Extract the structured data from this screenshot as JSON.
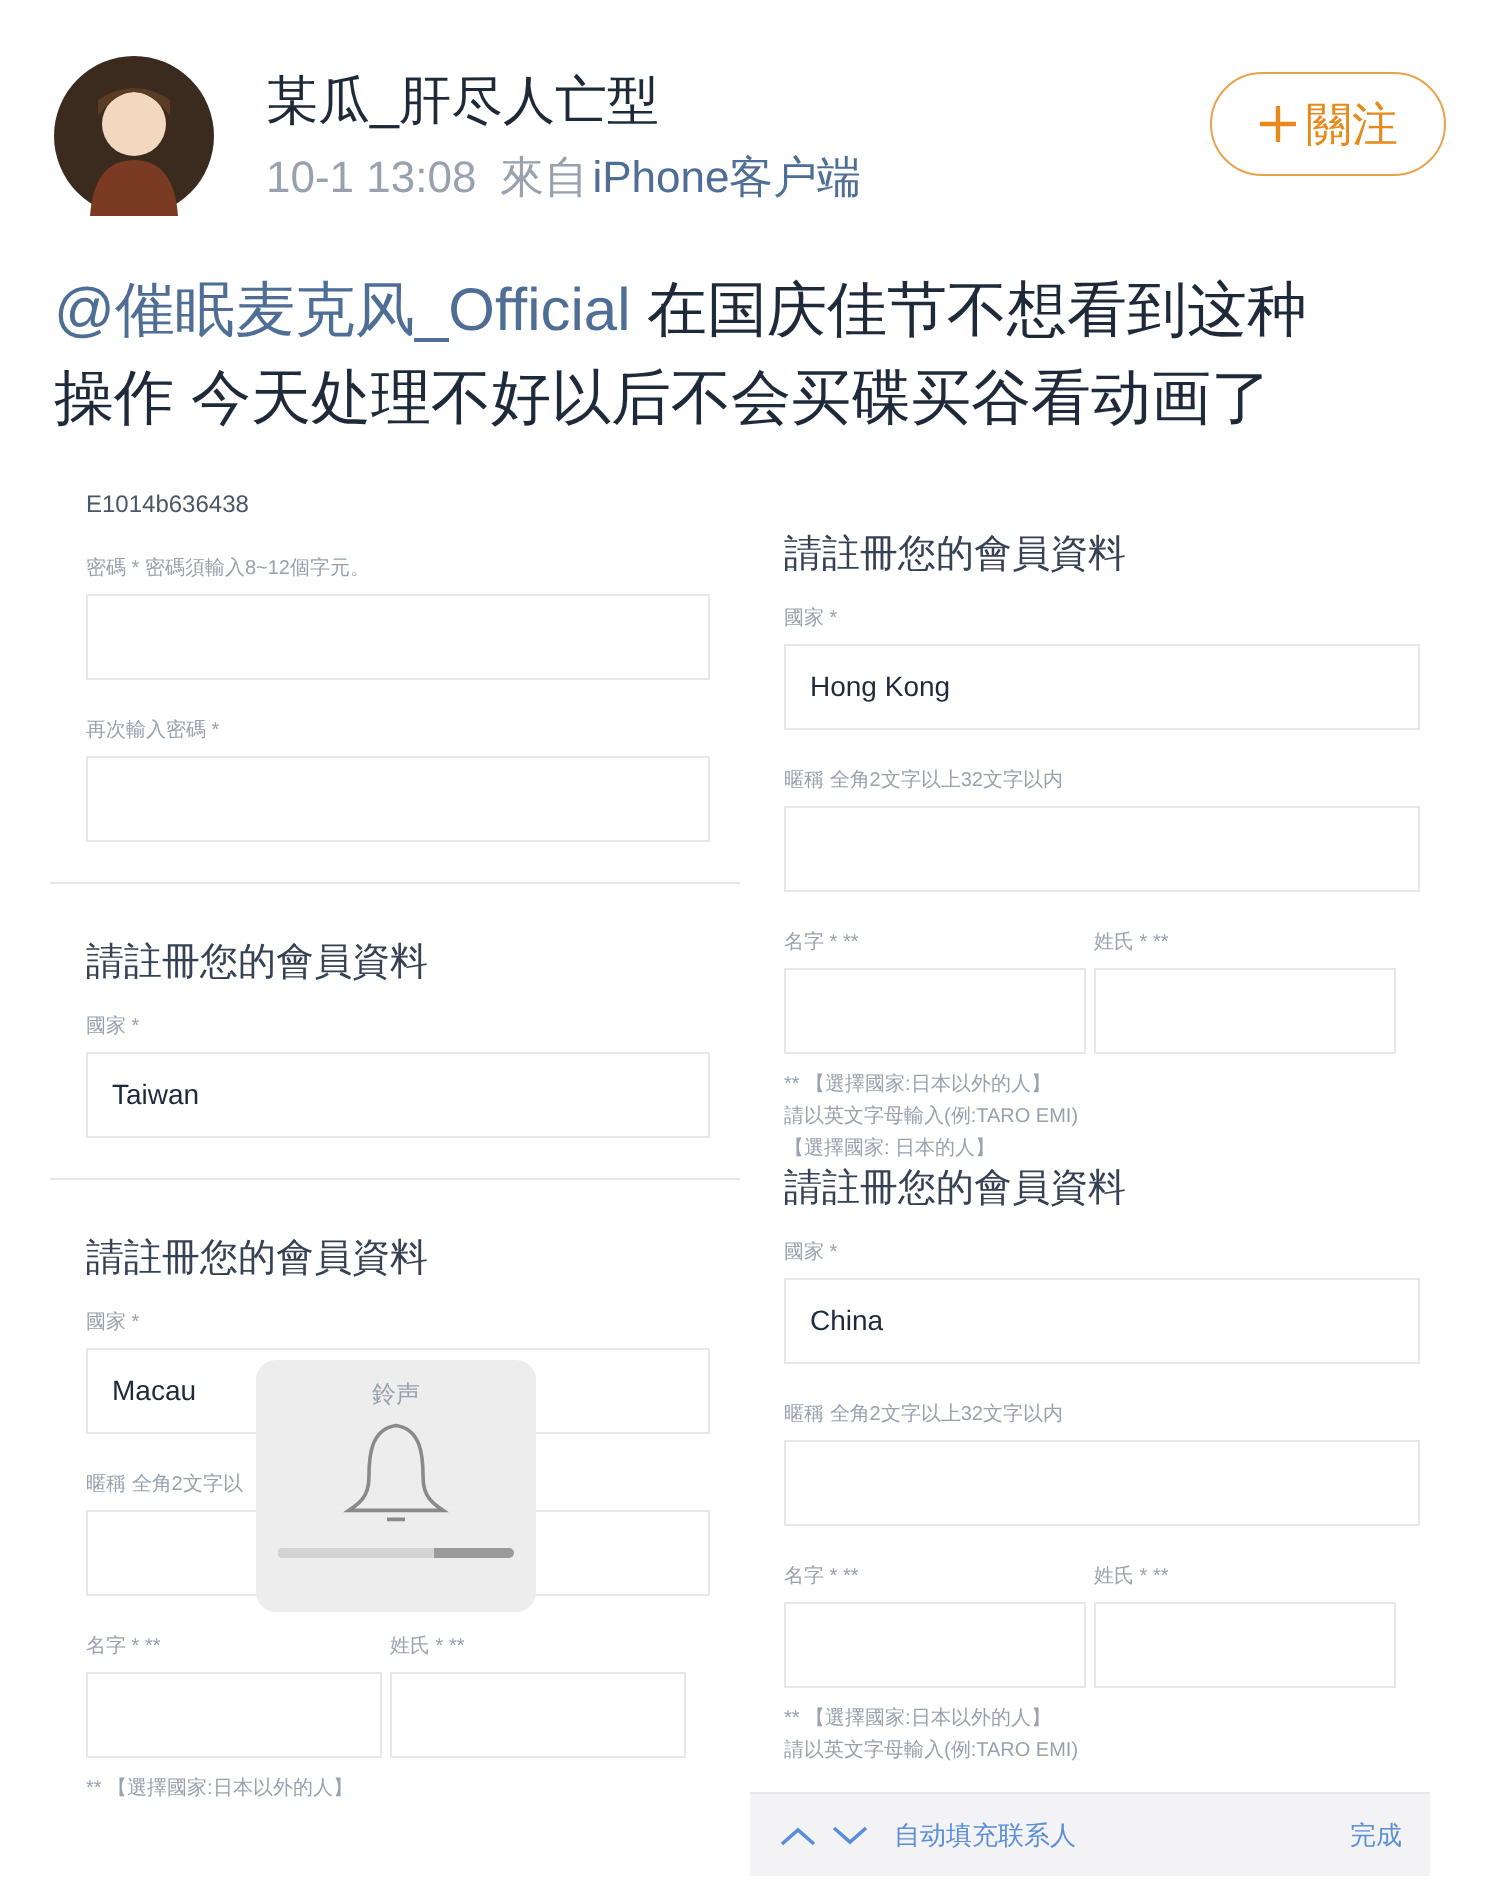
{
  "post": {
    "author": "某瓜_肝尽人亡型",
    "time": "10-1 13:08",
    "source_prefix": "來自",
    "source": "iPhone客户端",
    "follow_button": "關注",
    "mention": "@催眠麦克风_Official",
    "body": "在国庆佳节不想看到这种操作 今天处理不好以后不会买碟买谷看动画了"
  },
  "screenshot": {
    "left_column": [
      {
        "kind": "text",
        "text": "E1014b636438"
      },
      {
        "kind": "field",
        "label": "密碼 * 密碼須輸入8~12個字元。"
      },
      {
        "kind": "field",
        "label": "再次輸入密碼 *"
      },
      {
        "kind": "divider"
      },
      {
        "kind": "heading",
        "text": "請註冊您的會員資料"
      },
      {
        "kind": "field",
        "label": "國家 *",
        "value": "Taiwan"
      },
      {
        "kind": "divider"
      },
      {
        "kind": "heading",
        "text": "請註冊您的會員資料"
      },
      {
        "kind": "field",
        "label": "國家 *",
        "value": "Macau"
      },
      {
        "kind": "field",
        "label": "暱稱 全角2文字以"
      },
      {
        "kind": "name_pair",
        "fields": [
          {
            "label": "名字 * **"
          },
          {
            "label": "姓氏 * **"
          }
        ]
      },
      {
        "kind": "note",
        "text": "** 【選擇國家:日本以外的人】"
      }
    ],
    "right_column": [
      {
        "kind": "heading",
        "text": "請註冊您的會員資料"
      },
      {
        "kind": "field",
        "label": "國家 *",
        "value": "Hong Kong"
      },
      {
        "kind": "field",
        "label": "暱稱 全角2文字以上32文字以内"
      },
      {
        "kind": "name_pair",
        "fields": [
          {
            "label": "名字 * **"
          },
          {
            "label": "姓氏 * **"
          }
        ]
      },
      {
        "kind": "note",
        "text": "** 【選擇國家:日本以外的人】"
      },
      {
        "kind": "note",
        "text": "請以英文字母輸入(例:TARO EMI)"
      },
      {
        "kind": "note",
        "text": "【選擇國家: 日本的人】"
      },
      {
        "kind": "heading",
        "text": "請註冊您的會員資料"
      },
      {
        "kind": "field",
        "label": "國家 *",
        "value": "China"
      },
      {
        "kind": "field",
        "label": "暱稱 全角2文字以上32文字以内"
      },
      {
        "kind": "name_pair",
        "fields": [
          {
            "label": "名字 * **"
          },
          {
            "label": "姓氏 * **"
          }
        ]
      },
      {
        "kind": "note",
        "text": "** 【選擇國家:日本以外的人】"
      },
      {
        "kind": "note",
        "text": "請以英文字母輸入(例:TARO EMI)"
      }
    ],
    "ringer_overlay": {
      "title": "鈴声",
      "level": 0.66
    },
    "keyboard_bar": {
      "autofill": "自动填充联系人",
      "done": "完成"
    }
  }
}
